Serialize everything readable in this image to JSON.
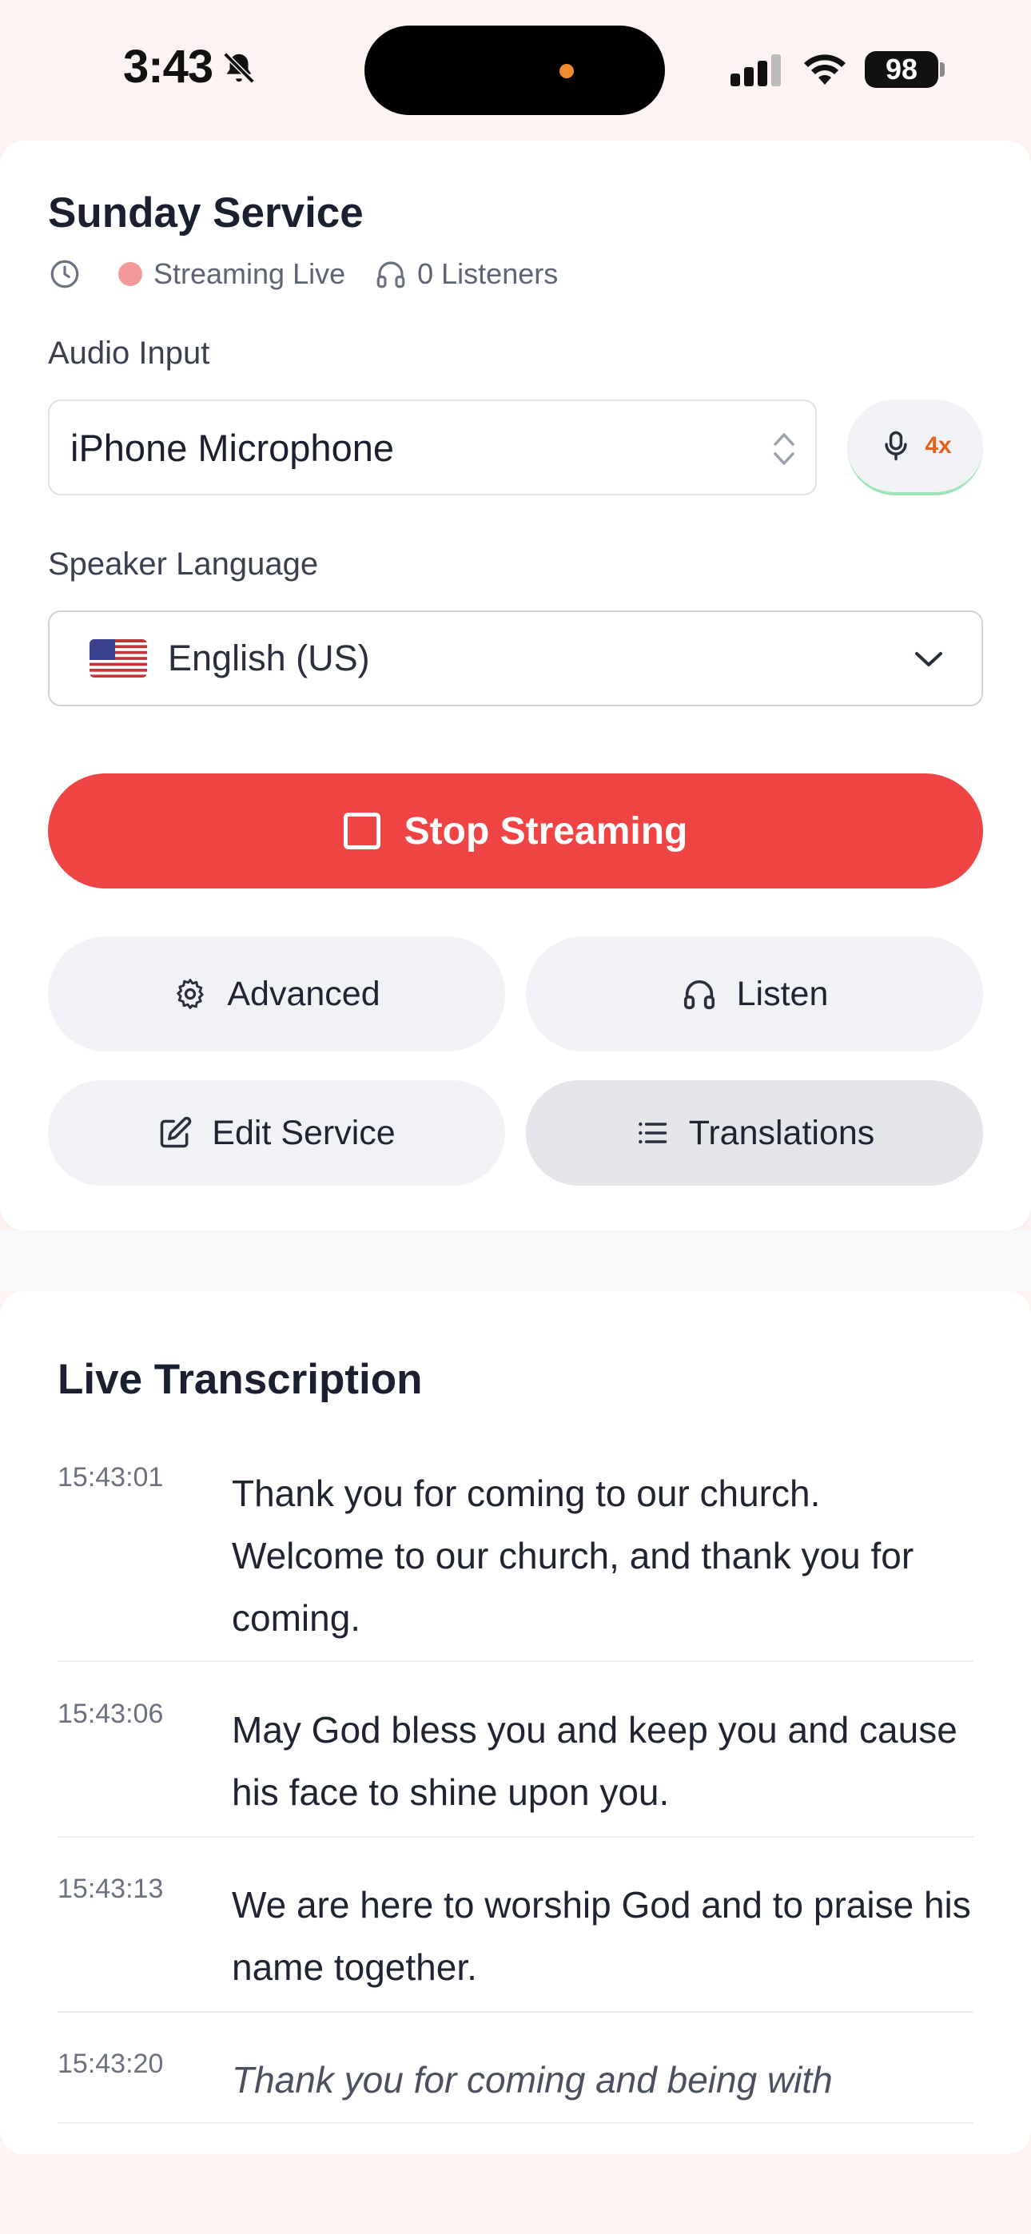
{
  "status_bar": {
    "time": "3:43",
    "battery": "98"
  },
  "service": {
    "title": "Sunday Service",
    "status": "Streaming Live",
    "listeners": "0 Listeners"
  },
  "audio_input": {
    "label": "Audio Input",
    "value": "iPhone Microphone",
    "gain": "4x"
  },
  "speaker_language": {
    "label": "Speaker Language",
    "value": "English (US)"
  },
  "buttons": {
    "stop": "Stop Streaming",
    "advanced": "Advanced",
    "listen": "Listen",
    "edit": "Edit Service",
    "translations": "Translations"
  },
  "transcription": {
    "title": "Live Transcription",
    "entries": [
      {
        "time": "15:43:01",
        "text": "Thank you for coming to our church. Welcome to our church, and thank you for coming."
      },
      {
        "time": "15:43:06",
        "text": "May God bless you and keep you and cause his face to shine upon you."
      },
      {
        "time": "15:43:13",
        "text": "We are here to worship God and to praise his name together."
      },
      {
        "time": "15:43:20",
        "text": "Thank you for coming and being with"
      }
    ]
  },
  "colors": {
    "accent_red": "#ef4444",
    "live_dot": "#f29a9a",
    "gain_orange": "#e2621b"
  },
  "icons": [
    "bell-slash-icon",
    "signal-icon",
    "wifi-icon",
    "clock-icon",
    "headphones-icon",
    "updown-chevron-icon",
    "microphone-icon",
    "chevron-down-icon",
    "stop-square-icon",
    "gear-icon",
    "edit-icon",
    "list-icon"
  ]
}
